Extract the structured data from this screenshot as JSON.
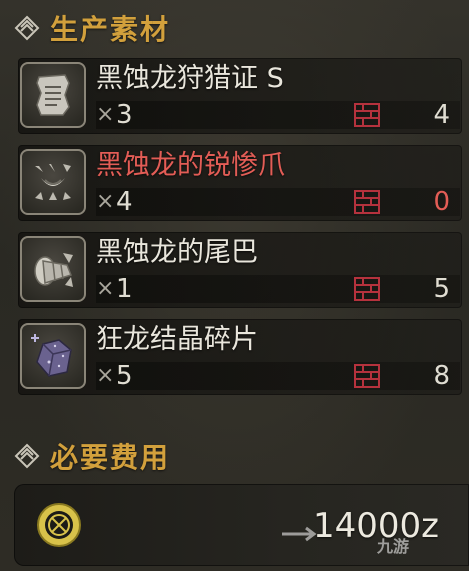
{
  "materials_section": {
    "title": "生产素材"
  },
  "times_symbol": "×",
  "materials": [
    {
      "icon": "ticket-icon",
      "name": "黑蚀龙狩猎证 S",
      "required": "3",
      "owned": "4",
      "insufficient": false
    },
    {
      "icon": "claw-icon",
      "name": "黑蚀龙的锐惨爪",
      "required": "4",
      "owned": "0",
      "insufficient": true
    },
    {
      "icon": "tail-icon",
      "name": "黑蚀龙的尾巴",
      "required": "1",
      "owned": "5",
      "insufficient": false
    },
    {
      "icon": "crystal-icon",
      "name": "狂龙结晶碎片",
      "required": "5",
      "owned": "8",
      "insufficient": false
    }
  ],
  "cost_section": {
    "title": "必要费用",
    "amount": "14000z"
  },
  "watermark": "九游",
  "colors": {
    "header": "#d2a03c",
    "alert": "#e35d56",
    "storage": "#b5323d"
  }
}
